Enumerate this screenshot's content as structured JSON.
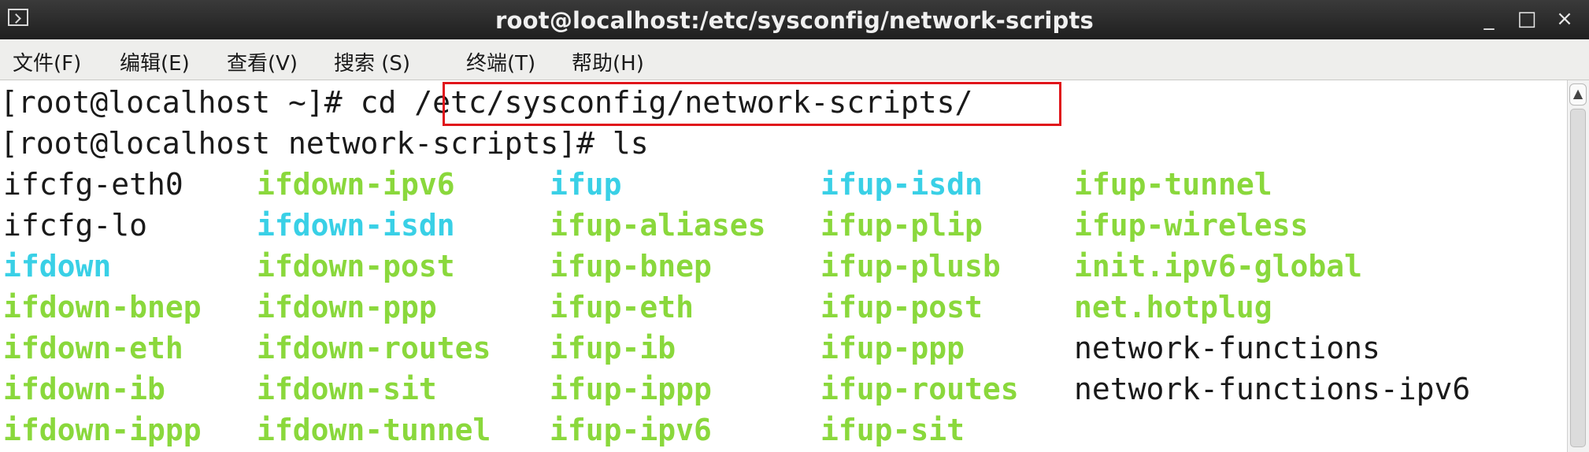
{
  "window": {
    "title": "root@localhost:/etc/sysconfig/network-scripts",
    "icon": "terminal-icon",
    "controls": {
      "minimize": "_",
      "maximize": "□",
      "close": "×"
    }
  },
  "menu": [
    "文件(F)",
    "编辑(E)",
    "查看(V)",
    "搜索 (S)",
    "终端(T)",
    "帮助(H)"
  ],
  "terminal": {
    "line1": {
      "prompt": "[root@localhost ~]# ",
      "command": "cd ",
      "argument": "/etc/sysconfig/network-scripts/"
    },
    "line2": {
      "prompt": "[root@localhost network-scripts]# ",
      "command": "ls"
    },
    "listing": [
      [
        {
          "t": "ifcfg-eth0",
          "k": "plain"
        },
        {
          "t": "ifdown-ipv6",
          "k": "exec"
        },
        {
          "t": "ifup",
          "k": "link"
        },
        {
          "t": "ifup-isdn",
          "k": "link"
        },
        {
          "t": "ifup-tunnel",
          "k": "exec"
        }
      ],
      [
        {
          "t": "ifcfg-lo",
          "k": "plain"
        },
        {
          "t": "ifdown-isdn",
          "k": "link"
        },
        {
          "t": "ifup-aliases",
          "k": "exec"
        },
        {
          "t": "ifup-plip",
          "k": "exec"
        },
        {
          "t": "ifup-wireless",
          "k": "exec"
        }
      ],
      [
        {
          "t": "ifdown",
          "k": "link"
        },
        {
          "t": "ifdown-post",
          "k": "exec"
        },
        {
          "t": "ifup-bnep",
          "k": "exec"
        },
        {
          "t": "ifup-plusb",
          "k": "exec"
        },
        {
          "t": "init.ipv6-global",
          "k": "exec"
        }
      ],
      [
        {
          "t": "ifdown-bnep",
          "k": "exec"
        },
        {
          "t": "ifdown-ppp",
          "k": "exec"
        },
        {
          "t": "ifup-eth",
          "k": "exec"
        },
        {
          "t": "ifup-post",
          "k": "exec"
        },
        {
          "t": "net.hotplug",
          "k": "exec"
        }
      ],
      [
        {
          "t": "ifdown-eth",
          "k": "exec"
        },
        {
          "t": "ifdown-routes",
          "k": "exec"
        },
        {
          "t": "ifup-ib",
          "k": "exec"
        },
        {
          "t": "ifup-ppp",
          "k": "exec"
        },
        {
          "t": "network-functions",
          "k": "plain"
        }
      ],
      [
        {
          "t": "ifdown-ib",
          "k": "exec"
        },
        {
          "t": "ifdown-sit",
          "k": "exec"
        },
        {
          "t": "ifup-ippp",
          "k": "exec"
        },
        {
          "t": "ifup-routes",
          "k": "exec"
        },
        {
          "t": "network-functions-ipv6",
          "k": "plain"
        }
      ],
      [
        {
          "t": "ifdown-ippp",
          "k": "exec"
        },
        {
          "t": "ifdown-tunnel",
          "k": "exec"
        },
        {
          "t": "ifup-ipv6",
          "k": "exec"
        },
        {
          "t": "ifup-sit",
          "k": "exec"
        },
        {
          "t": "",
          "k": "plain"
        }
      ]
    ]
  },
  "colors": {
    "executable": "#8ad83c",
    "symlink": "#39d0e6",
    "plain": "#1a1a1a",
    "highlight_box": "#e0151b",
    "titlebar": "#2a2a2a"
  }
}
